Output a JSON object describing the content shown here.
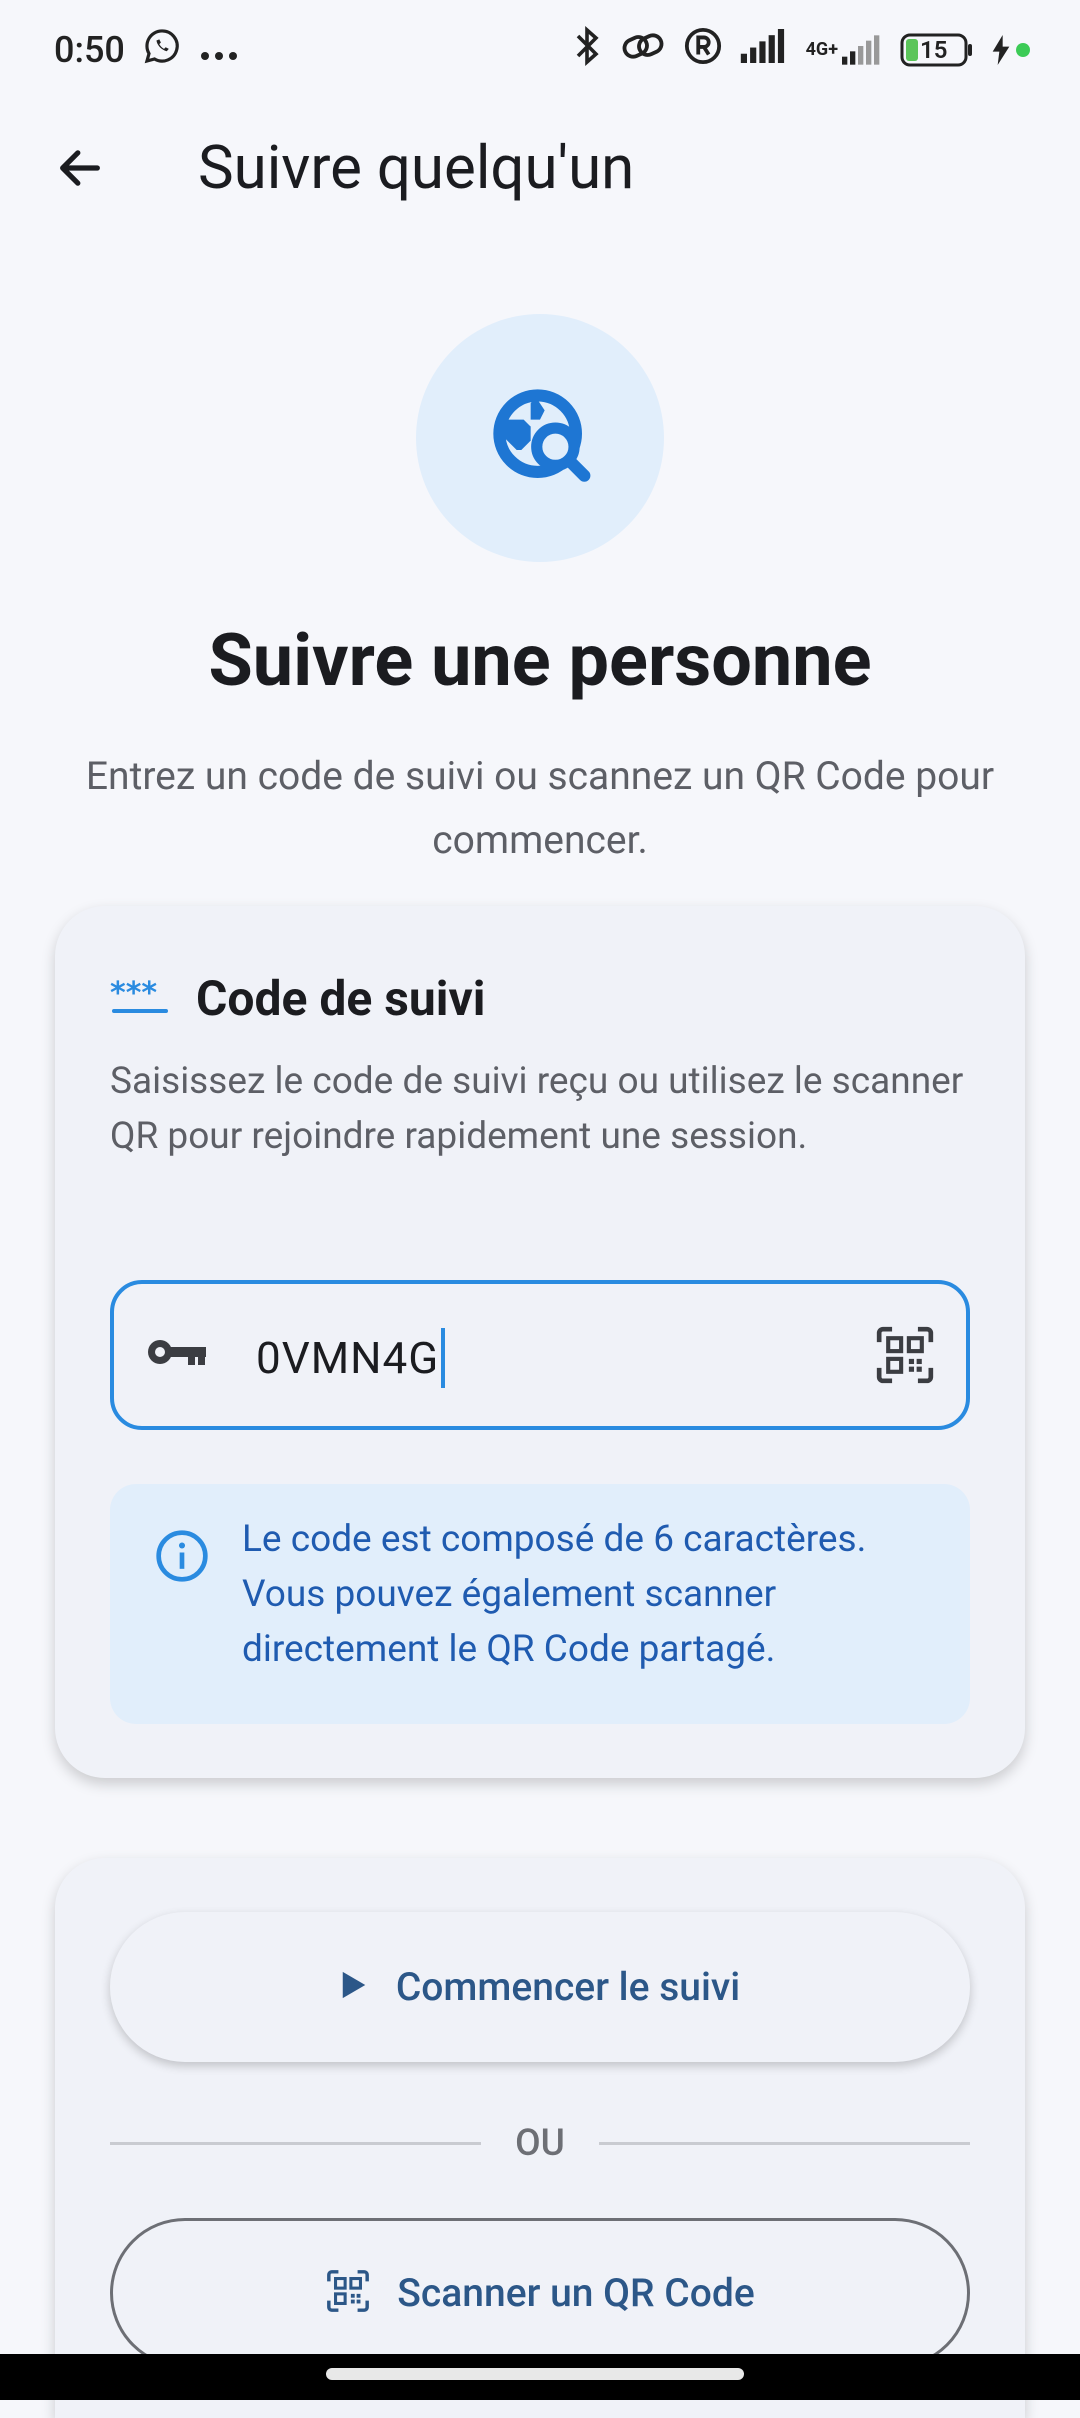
{
  "status_bar": {
    "time": "0:50",
    "battery": "15",
    "network": "4G+",
    "icons": [
      "whatsapp-icon",
      "more-icon",
      "bluetooth-icon",
      "link-icon",
      "registered-icon",
      "signal-icon",
      "battery-icon",
      "charging-icon"
    ]
  },
  "app_bar": {
    "title": "Suivre quelqu'un",
    "back_icon": "arrow-back-icon"
  },
  "hero": {
    "icon": "travel-explore-icon",
    "title": "Suivre une personne",
    "subtitle": "Entrez un code de suivi ou scannez un QR Code pour commencer."
  },
  "code_card": {
    "icon": "password-icon",
    "title": "Code de suivi",
    "description": "Saisissez le code de suivi reçu ou utilisez le scanner QR pour rejoindre rapidement une session.",
    "input": {
      "value": "0VMN4G",
      "leading_icon": "key-icon",
      "trailing_icon": "qr-scanner-icon"
    },
    "info": {
      "icon": "info-icon",
      "text": "Le code est composé de 6 caractères. Vous pouvez également scanner directement le QR Code partagé."
    }
  },
  "actions": {
    "start_label": "Commencer le suivi",
    "start_icon": "play-icon",
    "divider_text": "OU",
    "scan_label": "Scanner un QR Code",
    "scan_icon": "qr-scanner-icon"
  },
  "colors": {
    "primary": "#2a8be0",
    "primary_dark": "#1f5bb0",
    "button_text": "#2c5788",
    "hero_bg": "#e1eefb",
    "background": "#f6f7fb",
    "card": "#f0f2f8"
  }
}
